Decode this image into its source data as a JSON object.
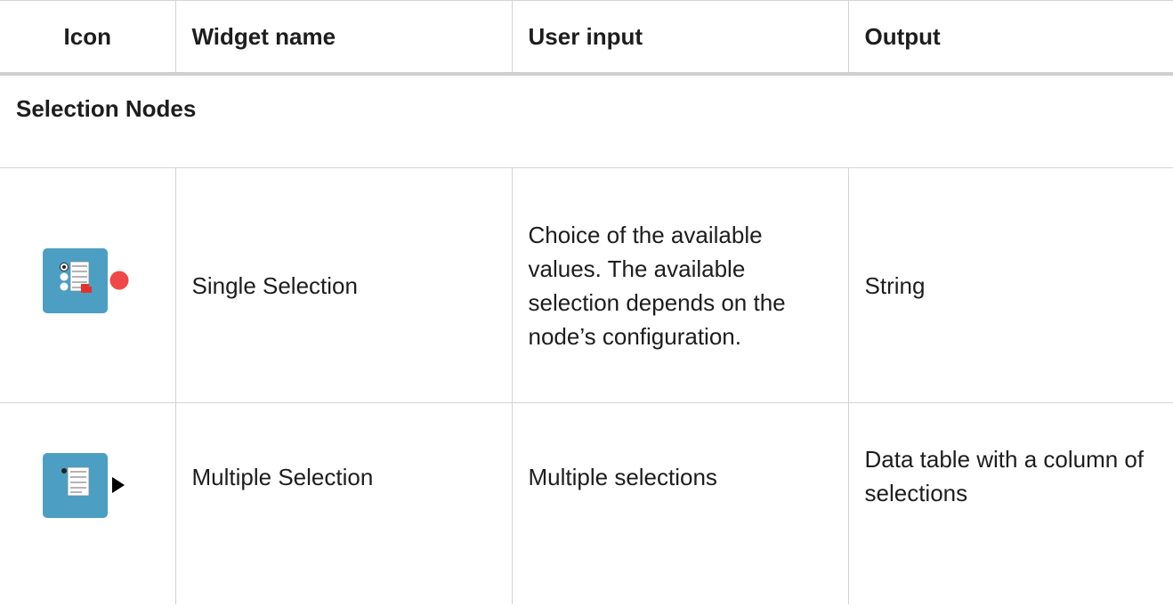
{
  "table": {
    "headers": {
      "icon": "Icon",
      "widget_name": "Widget name",
      "user_input": "User input",
      "output": "Output"
    },
    "section_title": "Selection Nodes",
    "rows": [
      {
        "icon": "single-selection-node-icon",
        "widget_name": "Single Selection",
        "user_input": "Choice of the available values. The available selection depends on the node’s configuration.",
        "output": "String"
      },
      {
        "icon": "multiple-selection-node-icon",
        "widget_name": "Multiple Selection",
        "user_input": "Multiple selections",
        "output": "Data table with a column of selections"
      }
    ]
  },
  "colors": {
    "node_blue": "#4c9fc2",
    "flow_variable_port": "#f04848",
    "table_port": "#000000",
    "border": "#d4d4d4"
  }
}
